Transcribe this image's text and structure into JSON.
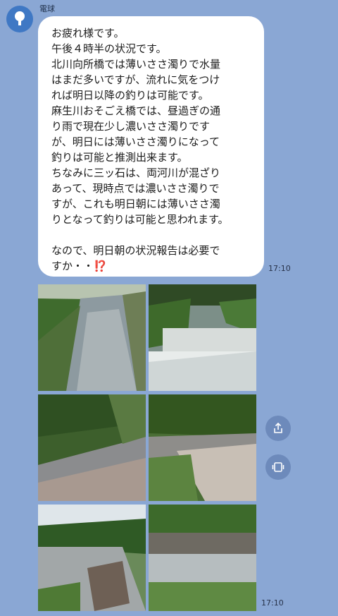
{
  "sender": {
    "name": "電球",
    "avatar_icon": "lightbulb-icon"
  },
  "message": {
    "text": "お疲れ様です。\n午後４時半の状況です。\n北川向所橋では薄いささ濁りで水量\nはまだ多いですが、流れに気をつけ\nれば明日以降の釣りは可能です。\n麻生川おそごえ橋では、昼過ぎの通\nり雨で現在少し濃いささ濁りです\nが、明日には薄いささ濁りになって\n釣りは可能と推測出来ます。\nちなみに三ッ石は、両河川が混ざり\nあって、現時点では濃いささ濁りで\nすが、これも明日朝には薄いささ濁\nりとなって釣りは可能と思われます。\n\nなので、明日朝の状況報告は必要で\nすか・・",
    "emoji": "⁉️",
    "time": "17:10"
  },
  "photos": {
    "count": 6,
    "time": "17:10",
    "items": [
      {
        "alt": "river-photo-1"
      },
      {
        "alt": "weir-photo-2"
      },
      {
        "alt": "river-photo-3"
      },
      {
        "alt": "river-photo-4"
      },
      {
        "alt": "river-photo-5"
      },
      {
        "alt": "river-photo-6"
      }
    ]
  },
  "actions": {
    "share_icon": "share-icon",
    "album_icon": "album-icon"
  },
  "colors": {
    "background": "#8aa7d4",
    "bubble": "#ffffff",
    "accent": "#3f78c4"
  }
}
